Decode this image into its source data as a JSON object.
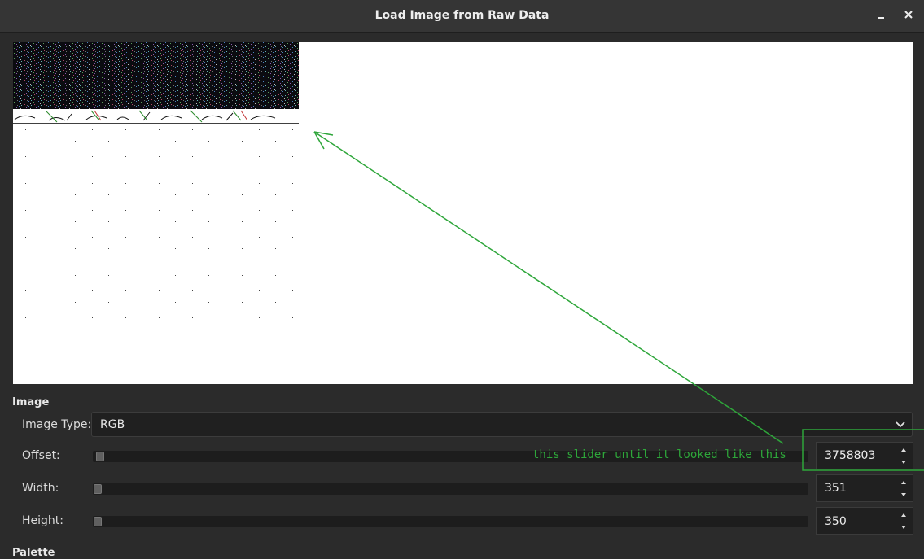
{
  "window": {
    "title": "Load Image from Raw Data",
    "minimize_icon": "minimize-icon",
    "close_icon": "close-icon"
  },
  "preview": {
    "description_icon": "raw-image-preview"
  },
  "image_section": {
    "title": "Image",
    "image_type": {
      "label": "Image Type:",
      "value": "RGB"
    },
    "offset": {
      "label": "Offset:",
      "value": "3758803"
    },
    "width": {
      "label": "Width:",
      "value": "351"
    },
    "height": {
      "label": "Height:",
      "value": "350"
    }
  },
  "palette_section": {
    "title": "Palette"
  },
  "annotation": {
    "text": "this slider until it looked like this",
    "color": "#2ea63a"
  },
  "colors": {
    "background": "#2b2b2b",
    "titlebar": "#353535",
    "field": "#202020",
    "preview": "#ffffff"
  }
}
